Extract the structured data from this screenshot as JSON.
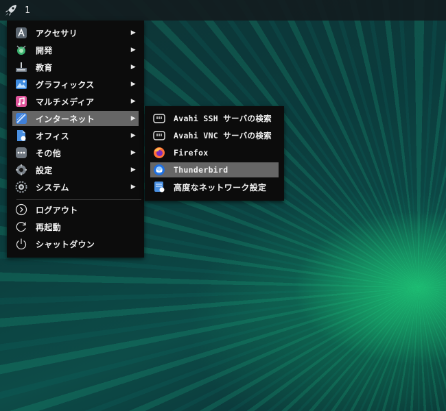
{
  "taskbar": {
    "start_icon": "rocket-icon",
    "workspace": "1"
  },
  "main_menu": {
    "items": [
      {
        "label": "アクセサリ",
        "icon": "accessories-icon",
        "has_submenu": true
      },
      {
        "label": "開発",
        "icon": "development-icon",
        "has_submenu": true
      },
      {
        "label": "教育",
        "icon": "education-icon",
        "has_submenu": true
      },
      {
        "label": "グラフィックス",
        "icon": "graphics-icon",
        "has_submenu": true
      },
      {
        "label": "マルチメディア",
        "icon": "multimedia-icon",
        "has_submenu": true
      },
      {
        "label": "インターネット",
        "icon": "internet-icon",
        "has_submenu": true,
        "active": true
      },
      {
        "label": "オフィス",
        "icon": "office-icon",
        "has_submenu": true
      },
      {
        "label": "その他",
        "icon": "other-icon",
        "has_submenu": true
      },
      {
        "label": "設定",
        "icon": "settings-icon",
        "has_submenu": true
      },
      {
        "label": "システム",
        "icon": "system-icon",
        "has_submenu": true
      }
    ],
    "session": [
      {
        "label": "ログアウト",
        "icon": "logout-icon"
      },
      {
        "label": "再起動",
        "icon": "restart-icon"
      },
      {
        "label": "シャットダウン",
        "icon": "shutdown-icon"
      }
    ],
    "arrow": "▶"
  },
  "sub_menu": {
    "items": [
      {
        "label": "Avahi SSH サーバの検索",
        "icon": "network-server-icon"
      },
      {
        "label": "Avahi VNC サーバの検索",
        "icon": "network-server-icon"
      },
      {
        "label": "Firefox",
        "icon": "firefox-icon"
      },
      {
        "label": "Thunderbird",
        "icon": "thunderbird-icon",
        "active": true
      },
      {
        "label": "高度なネットワーク設定",
        "icon": "network-settings-icon"
      }
    ]
  },
  "colors": {
    "menu_bg": "#0c0c0c",
    "highlight": "#666666",
    "taskbar": "#121c20"
  }
}
